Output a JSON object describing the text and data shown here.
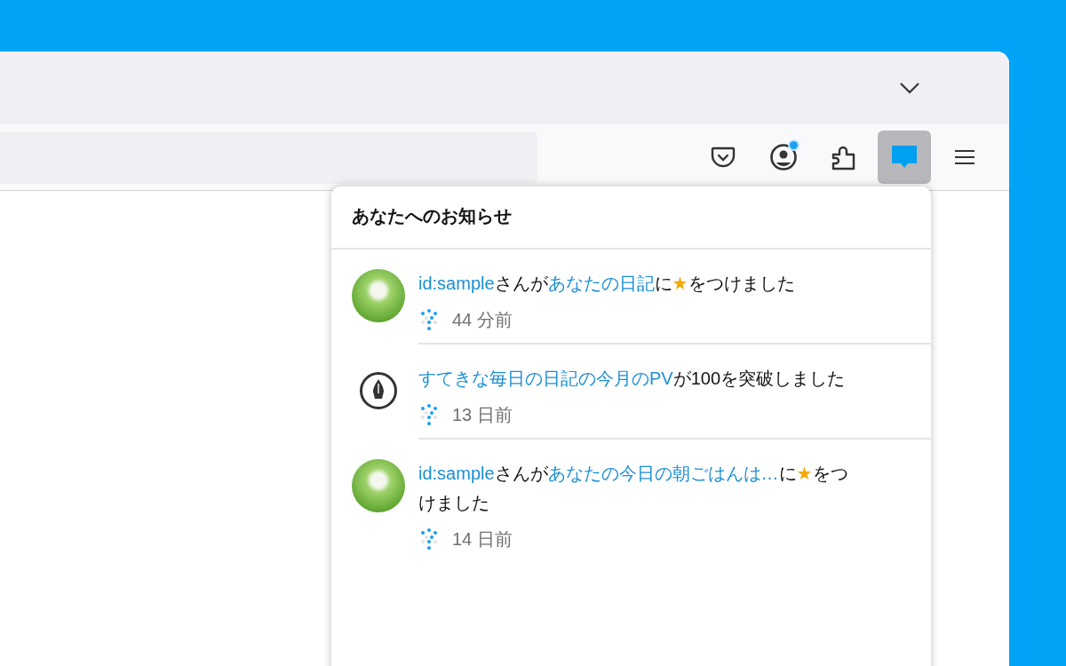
{
  "toolbar": {
    "buttons": [
      {
        "kind": "pocket",
        "selected": false,
        "dot": false
      },
      {
        "kind": "account",
        "selected": false,
        "dot": true
      },
      {
        "kind": "extensions",
        "selected": false,
        "dot": false
      },
      {
        "kind": "notifications",
        "selected": true,
        "dot": false
      },
      {
        "kind": "menu",
        "selected": false,
        "dot": false
      }
    ]
  },
  "panel": {
    "title": "あなたへのお知らせ",
    "items": [
      {
        "kind": "avatar",
        "message": [
          {
            "kind": "link",
            "text": "id:sample"
          },
          {
            "kind": "text",
            "text": "さんが"
          },
          {
            "kind": "link",
            "text": "あなたの日記"
          },
          {
            "kind": "text",
            "text": "に"
          },
          {
            "kind": "star",
            "text": "★"
          },
          {
            "kind": "text",
            "text": "をつけました"
          }
        ],
        "time": "44 分前"
      },
      {
        "kind": "pen",
        "message": [
          {
            "kind": "link",
            "text": "すてきな毎日の日記の今月のPV"
          },
          {
            "kind": "text",
            "text": "が100を突破しました"
          }
        ],
        "time": "13 日前"
      },
      {
        "kind": "avatar",
        "message": [
          {
            "kind": "link",
            "text": "id:sample"
          },
          {
            "kind": "text",
            "text": "さんが"
          },
          {
            "kind": "link",
            "text": "あなたの今日の朝ごはんは…"
          },
          {
            "kind": "text",
            "text": "に"
          },
          {
            "kind": "star",
            "text": "★"
          },
          {
            "kind": "text",
            "text": "をつけました"
          }
        ],
        "time": "14 日前"
      }
    ]
  }
}
